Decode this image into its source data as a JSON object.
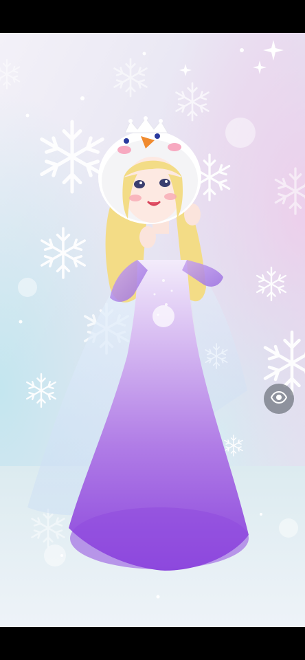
{
  "scene": {
    "description_icon": "avatar-3d-scene",
    "background_colors": [
      "#f1eef8",
      "#d8ecf4",
      "#f0d8ee"
    ],
    "dress_color": "#a05ce0",
    "hair_color": "#f3dc86",
    "hat_color": "#ffffff"
  },
  "controls": {
    "visibility_icon": "eye-icon",
    "visibility_button_color": "#6e737d"
  }
}
